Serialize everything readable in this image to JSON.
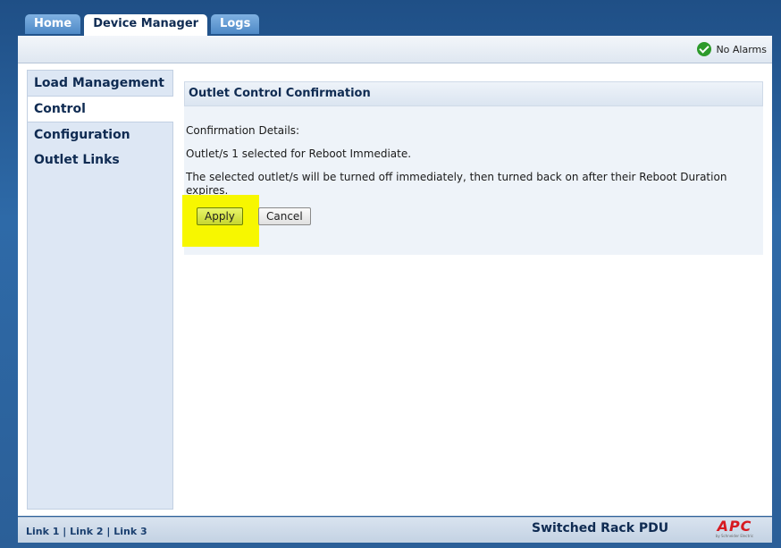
{
  "tabs": [
    {
      "label": "Home",
      "active": false
    },
    {
      "label": "Device Manager",
      "active": true
    },
    {
      "label": "Logs",
      "active": false
    }
  ],
  "status": {
    "alarm_text": "No Alarms",
    "alarm_icon": "check-circle-icon"
  },
  "sidebar": {
    "items": [
      {
        "label": "Load Management"
      },
      {
        "label": "Control",
        "selected": true
      },
      {
        "label": "Configuration"
      },
      {
        "label": "Outlet Links"
      }
    ]
  },
  "panel": {
    "title": "Outlet Control Confirmation",
    "details_label": "Confirmation Details:",
    "line1": "Outlet/s 1 selected for Reboot Immediate.",
    "line2": "The selected outlet/s will be turned off immediately, then turned back on after their Reboot Duration expires.",
    "apply_label": "Apply",
    "cancel_label": "Cancel"
  },
  "footer": {
    "links": [
      "Link 1",
      "Link 2",
      "Link 3"
    ],
    "separator": "|",
    "product": "Switched Rack PDU",
    "logo_text": "APC",
    "logo_sub": "by Schneider Electric"
  },
  "colors": {
    "header_blue": "#2e6aa8",
    "nav_text": "#0f2b52",
    "highlight": "#f7f700",
    "apply_button": "#c6d630",
    "logo_red": "#d71920"
  }
}
